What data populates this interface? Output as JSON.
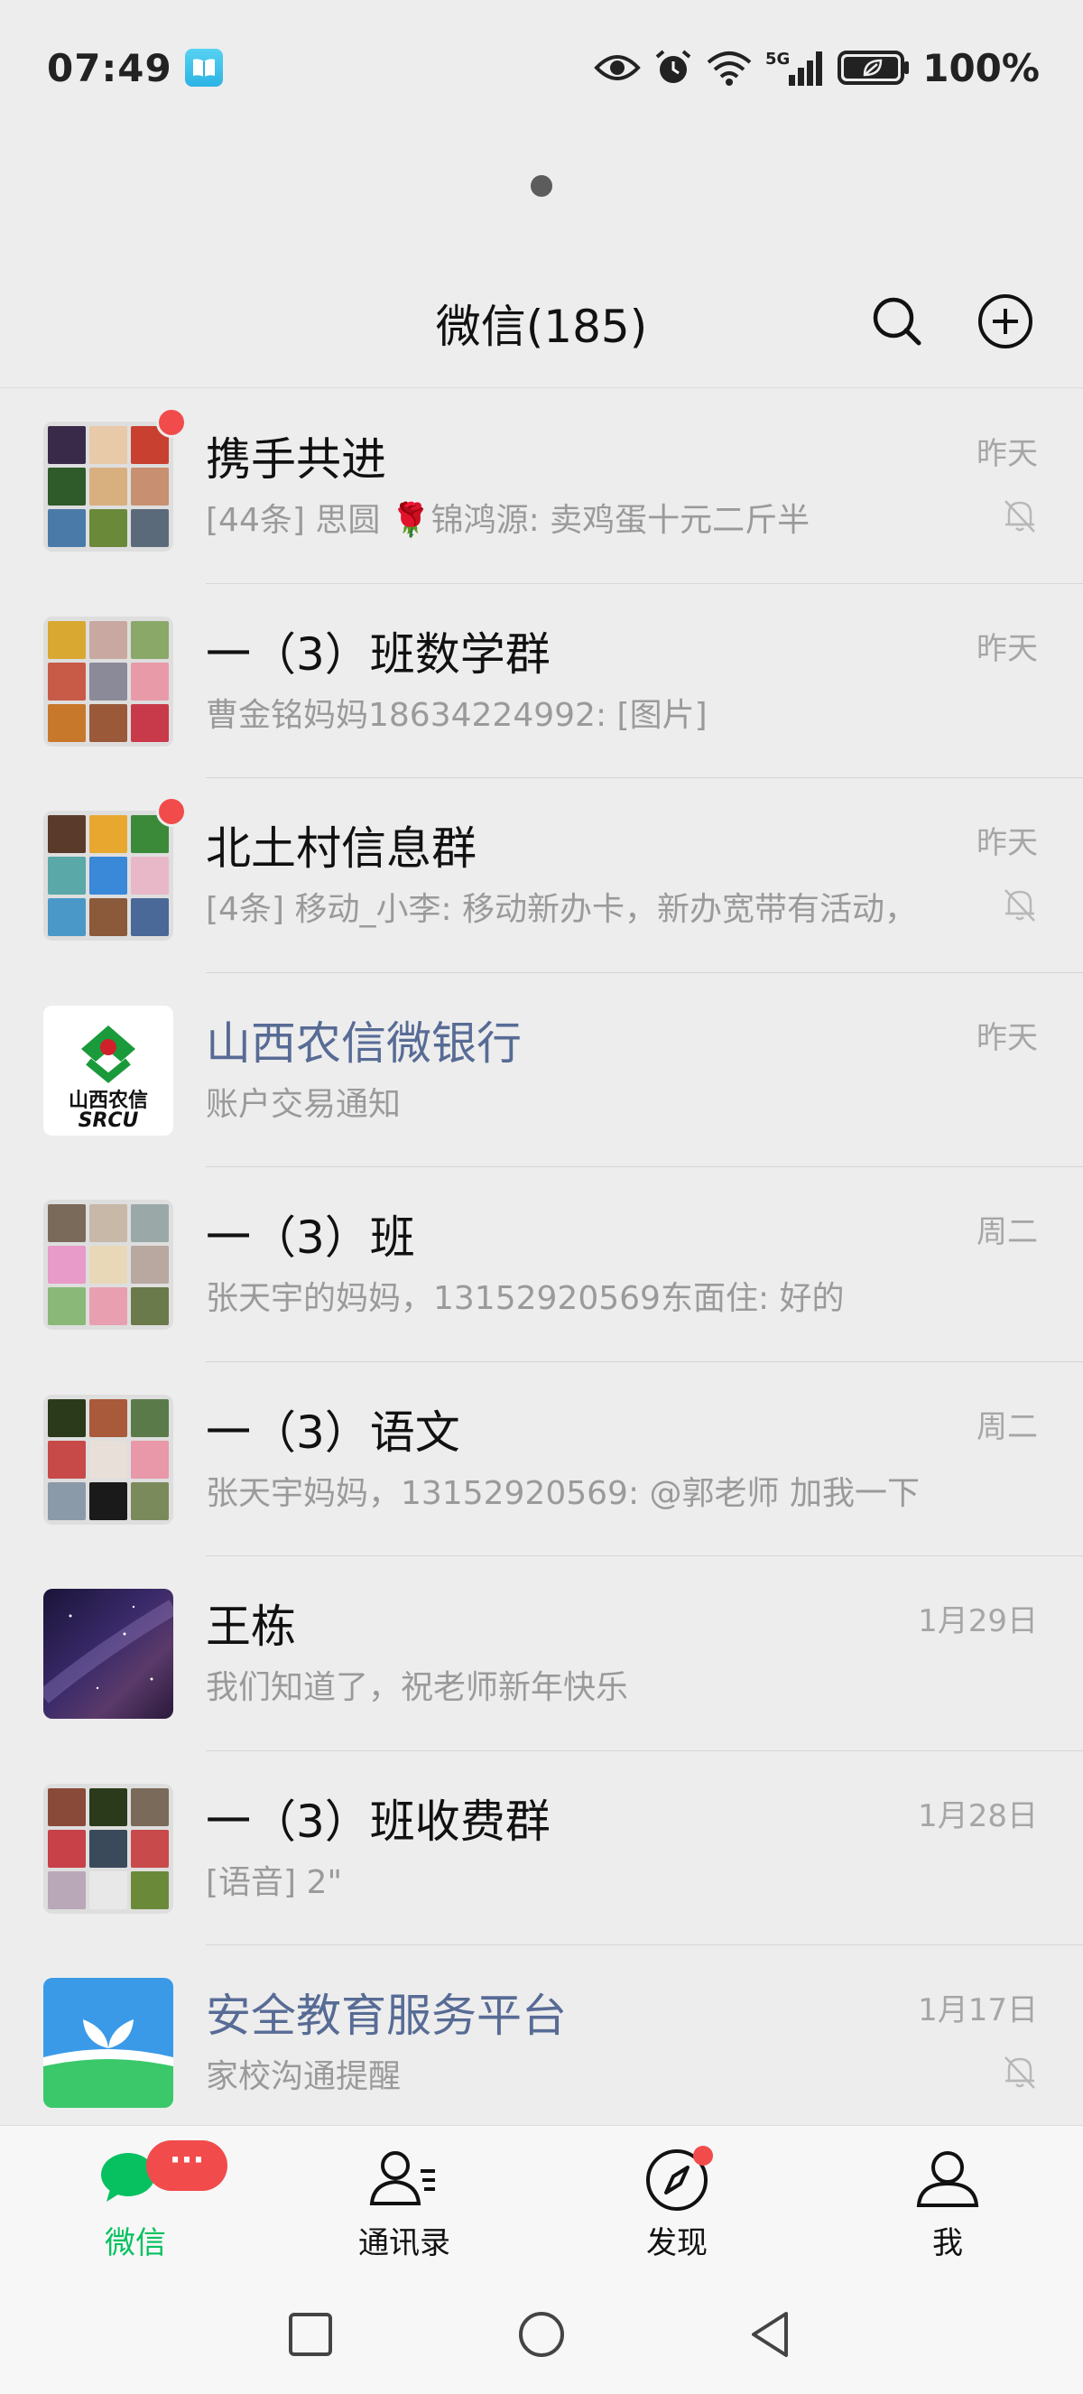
{
  "status_bar": {
    "time": "07:49",
    "network": "5G",
    "battery": "100%"
  },
  "header": {
    "title": "微信(185)"
  },
  "chats": [
    {
      "name": "携手共进",
      "preview": "[44条] 思圆 🌹锦鸿源: 卖鸡蛋十元二斤半",
      "time": "昨天",
      "unread": true,
      "muted": true,
      "official": false
    },
    {
      "name": "一（3）班数学群",
      "preview": "曹金铭妈妈18634224992: [图片]",
      "time": "昨天",
      "unread": false,
      "muted": false,
      "official": false
    },
    {
      "name": "北土村信息群",
      "preview": "[4条] 移动_小李: 移动新办卡，新办宽带有活动，",
      "time": "昨天",
      "unread": true,
      "muted": true,
      "official": false
    },
    {
      "name": "山西农信微银行",
      "preview": "账户交易通知",
      "time": "昨天",
      "unread": false,
      "muted": false,
      "official": true,
      "logo_text": "山西农信",
      "logo_sub": "SRCU"
    },
    {
      "name": "一（3）班",
      "preview": "张天宇的妈妈，13152920569东面住: 好的",
      "time": "周二",
      "unread": false,
      "muted": false,
      "official": false
    },
    {
      "name": "一（3）语文",
      "preview": "张天宇妈妈，13152920569: @郭老师 加我一下",
      "time": "周二",
      "unread": false,
      "muted": false,
      "official": false
    },
    {
      "name": "王栋",
      "preview": "我们知道了，祝老师新年快乐",
      "time": "1月29日",
      "unread": false,
      "muted": false,
      "official": false
    },
    {
      "name": "一（3）班收费群",
      "preview": "[语音] 2\"",
      "time": "1月28日",
      "unread": false,
      "muted": false,
      "official": false
    },
    {
      "name": "安全教育服务平台",
      "preview": "家校沟通提醒",
      "time": "1月17日",
      "unread": false,
      "muted": true,
      "official": true
    }
  ],
  "nav": {
    "chats": "微信",
    "contacts": "通讯录",
    "discover": "发现",
    "me": "我",
    "chats_badge": "···"
  },
  "colors": {
    "accent": "#07c160",
    "badge": "#f24b4b",
    "official_name": "#576b95",
    "background": "#ededed"
  }
}
